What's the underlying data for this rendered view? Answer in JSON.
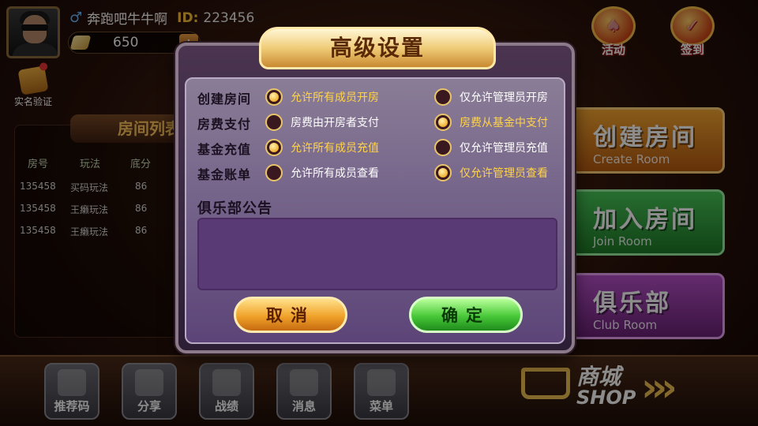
{
  "user": {
    "name": "奔跑吧牛牛啊",
    "id_label": "ID:",
    "id": "223456",
    "coins": "650",
    "coin_add": "+",
    "verify_label": "实名验证",
    "gender_icon": "male-icon"
  },
  "top_icons": [
    {
      "label": "活动",
      "icon": "activity-icon"
    },
    {
      "label": "签到",
      "icon": "checkin-icon"
    }
  ],
  "room_list": {
    "title": "房间列表",
    "headers": [
      "房号",
      "玩法",
      "底分"
    ],
    "rows": [
      {
        "no": "135458",
        "mode": "买码玩法",
        "base": "86"
      },
      {
        "no": "135458",
        "mode": "王癞玩法",
        "base": "86"
      },
      {
        "no": "135458",
        "mode": "王癞玩法",
        "base": "86"
      }
    ]
  },
  "menu": {
    "create": {
      "zh": "创建房间",
      "en": "Create Room"
    },
    "join": {
      "zh": "加入房间",
      "en": "Join Room"
    },
    "club": {
      "zh": "俱乐部",
      "en": "Club Room"
    }
  },
  "bottom_nav": [
    "推荐码",
    "分享",
    "战绩",
    "消息",
    "菜单"
  ],
  "shop": {
    "zh": "商城",
    "en": "SHOP"
  },
  "dialog": {
    "title": "高级设置",
    "settings": [
      {
        "label": "创建房间",
        "options": [
          {
            "text": "允许所有成员开房",
            "selected": true
          },
          {
            "text": "仅允许管理员开房",
            "selected": false
          }
        ]
      },
      {
        "label": "房费支付",
        "options": [
          {
            "text": "房费由开房者支付",
            "selected": false
          },
          {
            "text": "房费从基金中支付",
            "selected": true
          }
        ]
      },
      {
        "label": "基金充值",
        "options": [
          {
            "text": "允许所有成员充值",
            "selected": true
          },
          {
            "text": "仅允许管理员充值",
            "selected": false
          }
        ]
      },
      {
        "label": "基金账单",
        "options": [
          {
            "text": "允许所有成员查看",
            "selected": false
          },
          {
            "text": "仅允许管理员查看",
            "selected": true
          }
        ]
      }
    ],
    "notice_label": "俱乐部公告",
    "notice_text": "",
    "cancel_label": "取消",
    "confirm_label": "确定"
  },
  "colors": {
    "accent_gold": "#ffd34a",
    "confirm_green": "#48c838",
    "cancel_orange": "#f0a22a"
  }
}
